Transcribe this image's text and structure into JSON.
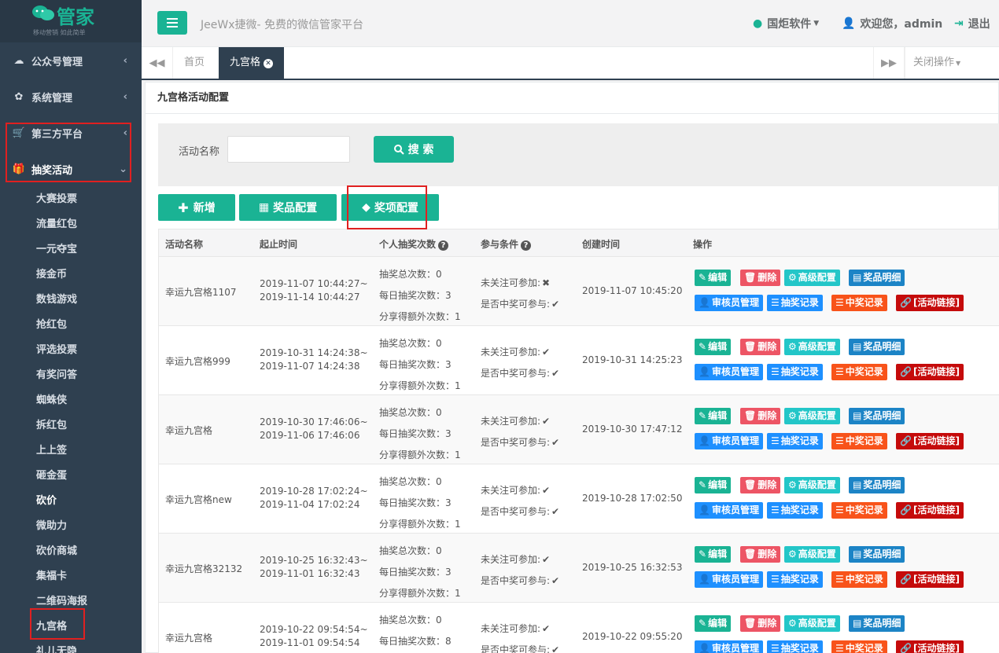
{
  "logo": {
    "text": "管家",
    "slogan": "移动营销 如此简单"
  },
  "sidebar": {
    "menus": [
      {
        "label": "公众号管理",
        "icon": "wechat-icon",
        "caret": "‹"
      },
      {
        "label": "系统管理",
        "icon": "gear-icon",
        "caret": "‹"
      },
      {
        "label": "第三方平台",
        "icon": "cart-icon",
        "caret": "‹"
      },
      {
        "label": "抽奖活动",
        "icon": "gift-icon",
        "caret": "⌄"
      }
    ],
    "sub_items": [
      "大赛投票",
      "流量红包",
      "一元夺宝",
      "接金币",
      "数钱游戏",
      "抢红包",
      "评选投票",
      "有奖问答",
      "蜘蛛侠",
      "拆红包",
      "上上签",
      "砸金蛋",
      "砍价",
      "微助力",
      "砍价商城",
      "集福卡",
      "二维码海报",
      "九宫格",
      "礼儿无隐"
    ]
  },
  "header": {
    "site_title": "JeeWx捷微- 免费的微信管家平台",
    "software_menu": "国炬软件",
    "welcome": "欢迎您，admin",
    "logout": "退出"
  },
  "tabs": {
    "items": [
      "首页",
      "九宫格"
    ],
    "close_ops": "关闭操作"
  },
  "panel": {
    "title": "九宫格活动配置",
    "search_label": "活动名称",
    "search_value": "",
    "search_button": "搜 索",
    "add_button": "新增",
    "prize_config_button": "奖品配置",
    "award_config_button": "奖项配置"
  },
  "table": {
    "headers": [
      "活动名称",
      "起止时间",
      "个人抽奖次数",
      "参与条件",
      "创建时间",
      "操作"
    ],
    "count_labels": [
      "抽奖总次数：",
      "每日抽奖次数：",
      "分享得额外次数："
    ],
    "cond_labels": [
      "未关注可参加:",
      "是否中奖可参与:"
    ],
    "op_labels": [
      "编辑",
      "删除",
      "高级配置",
      "奖品明细",
      "审核员管理",
      "抽奖记录",
      "中奖记录",
      "[活动链接]"
    ],
    "rows": [
      {
        "name": "幸运九宫格1107",
        "start": "2019-11-07 10:44:27~",
        "end": "2019-11-14 10:44:27",
        "counts": [
          "0",
          "3",
          "1"
        ],
        "cond": [
          "✖",
          "✔"
        ],
        "created": "2019-11-07 10:45:20"
      },
      {
        "name": "幸运九宫格999",
        "start": "2019-10-31 14:24:38~",
        "end": "2019-11-07 14:24:38",
        "counts": [
          "0",
          "3",
          "1"
        ],
        "cond": [
          "✔",
          "✔"
        ],
        "created": "2019-10-31 14:25:23"
      },
      {
        "name": "幸运九宫格",
        "start": "2019-10-30 17:46:06~",
        "end": "2019-11-06 17:46:06",
        "counts": [
          "0",
          "3",
          "1"
        ],
        "cond": [
          "✔",
          "✔"
        ],
        "created": "2019-10-30 17:47:12"
      },
      {
        "name": "幸运九宫格new",
        "start": "2019-10-28 17:02:24~",
        "end": "2019-11-04 17:02:24",
        "counts": [
          "0",
          "3",
          "1"
        ],
        "cond": [
          "✔",
          "✔"
        ],
        "created": "2019-10-28 17:02:50"
      },
      {
        "name": "幸运九宫格32132",
        "start": "2019-10-25 16:32:43~",
        "end": "2019-11-01 16:32:43",
        "counts": [
          "0",
          "3",
          "1"
        ],
        "cond": [
          "✔",
          "✔"
        ],
        "created": "2019-10-25 16:32:53"
      },
      {
        "name": "幸运九宫格",
        "start": "2019-10-22 09:54:54~",
        "end": "2019-11-01 09:54:54",
        "counts": [
          "0",
          "8",
          ""
        ],
        "cond": [
          "✔",
          "✔"
        ],
        "created": "2019-10-22 09:55:20"
      }
    ]
  },
  "colors": {
    "accent": "#1ab394",
    "sidebar": "#2f4050",
    "highlight": "#e02020"
  }
}
